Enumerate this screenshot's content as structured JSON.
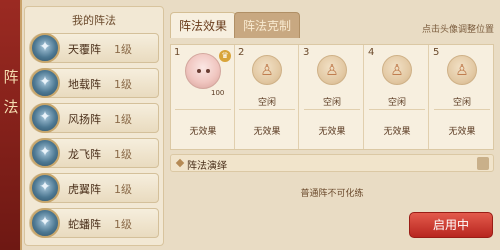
{
  "sidebar": {
    "frame_title": "阵法",
    "title": "我的阵法",
    "items": [
      {
        "name": "天覆阵",
        "level": "1级",
        "icon": "sky-formation-icon"
      },
      {
        "name": "地载阵",
        "level": "1级",
        "icon": "earth-formation-icon"
      },
      {
        "name": "风扬阵",
        "level": "1级",
        "icon": "wind-formation-icon"
      },
      {
        "name": "龙飞阵",
        "level": "1级",
        "icon": "dragon-formation-icon"
      },
      {
        "name": "虎翼阵",
        "level": "1级",
        "icon": "tiger-formation-icon"
      },
      {
        "name": "蛇蟠阵",
        "level": "1级",
        "icon": "snake-formation-icon"
      }
    ]
  },
  "tabs": [
    {
      "label": "阵法效果",
      "active": true
    },
    {
      "label": "阵法克制",
      "active": false
    }
  ],
  "hint": "点击头像调整位置",
  "slots": [
    {
      "number": "1",
      "occupied": true,
      "power": "100",
      "status": "",
      "effect": "无效果"
    },
    {
      "number": "2",
      "occupied": false,
      "status": "空闲",
      "effect": "无效果"
    },
    {
      "number": "3",
      "occupied": false,
      "status": "空闲",
      "effect": "无效果"
    },
    {
      "number": "4",
      "occupied": false,
      "status": "空闲",
      "effect": "无效果"
    },
    {
      "number": "5",
      "occupied": false,
      "status": "空闲",
      "effect": "无效果"
    }
  ],
  "section": {
    "title": "阵法演绎",
    "description": "普通阵不可化练"
  },
  "action_button": "启用中",
  "colors": {
    "frame_red": "#8a221b",
    "button_red": "#c8342a",
    "panel_bg": "#f7efdf"
  }
}
